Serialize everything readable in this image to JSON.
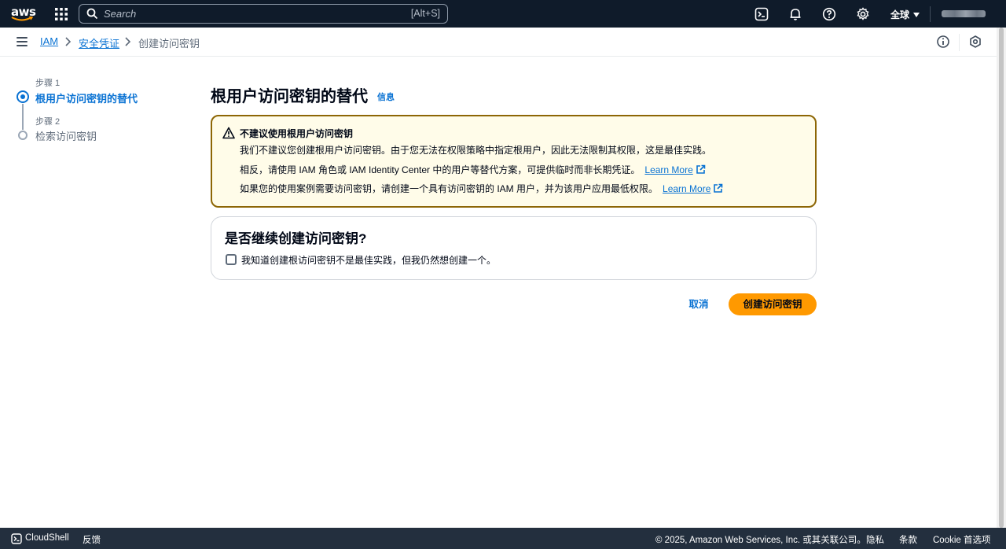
{
  "topnav": {
    "logo_text": "aws",
    "search_placeholder": "Search",
    "search_shortcut": "[Alt+S]",
    "region_label": "全球",
    "icons": [
      "grid-icon",
      "cloudshell-icon",
      "bell-icon",
      "help-icon",
      "gear-icon"
    ]
  },
  "breadcrumb": {
    "items": [
      "IAM",
      "安全凭证",
      "创建访问密钥"
    ]
  },
  "steps": [
    {
      "number": "步骤 1",
      "title": "根用户访问密钥的替代",
      "active": true
    },
    {
      "number": "步骤 2",
      "title": "检索访问密钥",
      "active": false
    }
  ],
  "main": {
    "title": "根用户访问密钥的替代",
    "info_link": "信息"
  },
  "alert": {
    "title": "不建议使用根用户访问密钥",
    "line1": "我们不建议您创建根用户访问密钥。由于您无法在权限策略中指定根用户，因此无法限制其权限，这是最佳实践。",
    "line2": "相反，请使用 IAM 角色或 IAM Identity Center 中的用户等替代方案，可提供临时而非长期凭证。",
    "line2_link": "Learn More",
    "line3": "如果您的使用案例需要访问密钥，请创建一个具有访问密钥的 IAM 用户，并为该用户应用最低权限。",
    "line3_link": "Learn More"
  },
  "confirm_card": {
    "title": "是否继续创建访问密钥?",
    "checkbox_label": "我知道创建根访问密钥不是最佳实践，但我仍然想创建一个。",
    "checked": false
  },
  "actions": {
    "cancel_label": "取消",
    "create_label": "创建访问密钥"
  },
  "footer": {
    "cloudshell": "CloudShell",
    "feedback": "反馈",
    "copyright": "© 2025, Amazon Web Services, Inc. 或其关联公司。",
    "privacy": "隐私",
    "terms": "条款",
    "cookie": "Cookie 首选项"
  },
  "colors": {
    "nav_bg": "#0f1b2a",
    "link": "#0972d3",
    "primary_button": "#ff9900",
    "alert_border": "#8d6605",
    "alert_bg": "#fffce9",
    "footer_bg": "#232f3e"
  }
}
